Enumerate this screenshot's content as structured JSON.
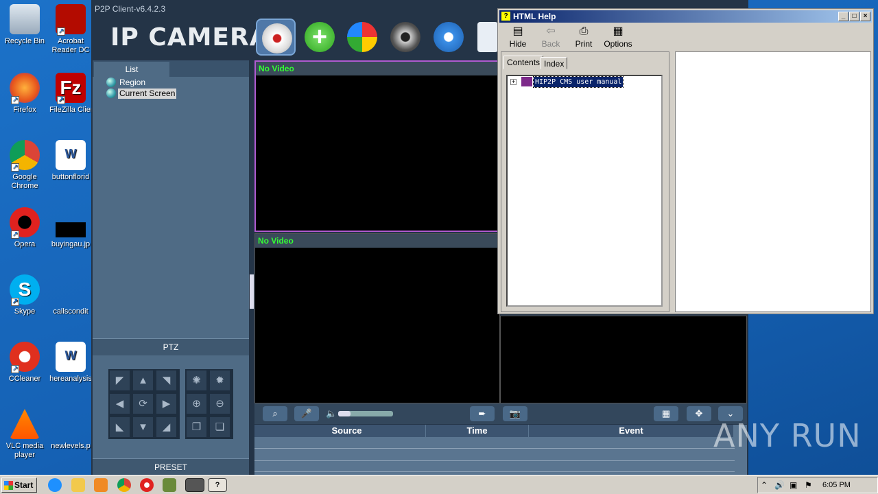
{
  "desktop": {
    "icons": [
      {
        "label": "Recycle Bin"
      },
      {
        "label": "Acrobat Reader DC"
      },
      {
        "label": "Firefox"
      },
      {
        "label": "FileZilla Client"
      },
      {
        "label": "Google Chrome"
      },
      {
        "label": "buttonflorid"
      },
      {
        "label": "Opera"
      },
      {
        "label": "buyingau.jp"
      },
      {
        "label": "Skype"
      },
      {
        "label": "callscondit"
      },
      {
        "label": "CCleaner"
      },
      {
        "label": "hereanalysis"
      },
      {
        "label": "VLC media player"
      },
      {
        "label": "newlevels.p"
      }
    ]
  },
  "p2p": {
    "title": "P2P Client-v6.4.2.3",
    "logo": "IP CAMERA",
    "tab_list": "List",
    "tree": [
      "Region",
      "Current Screen"
    ],
    "ptz_label": "PTZ",
    "preset_label": "PRESET",
    "screen1_status": "No Video",
    "screen2_status": "No Video",
    "event_columns": [
      "Source",
      "Time",
      "Event"
    ]
  },
  "help": {
    "title": "HTML Help",
    "toolbar": [
      "Hide",
      "Back",
      "Print",
      "Options"
    ],
    "tabs": [
      "Contents",
      "Index"
    ],
    "tree_item": "HIP2P CMS user manual"
  },
  "taskbar": {
    "start": "Start",
    "time": "6:05 PM"
  },
  "watermark": "ANY RUN",
  "colors": {
    "accent": "#0a246a",
    "status_green": "#33ff33"
  }
}
